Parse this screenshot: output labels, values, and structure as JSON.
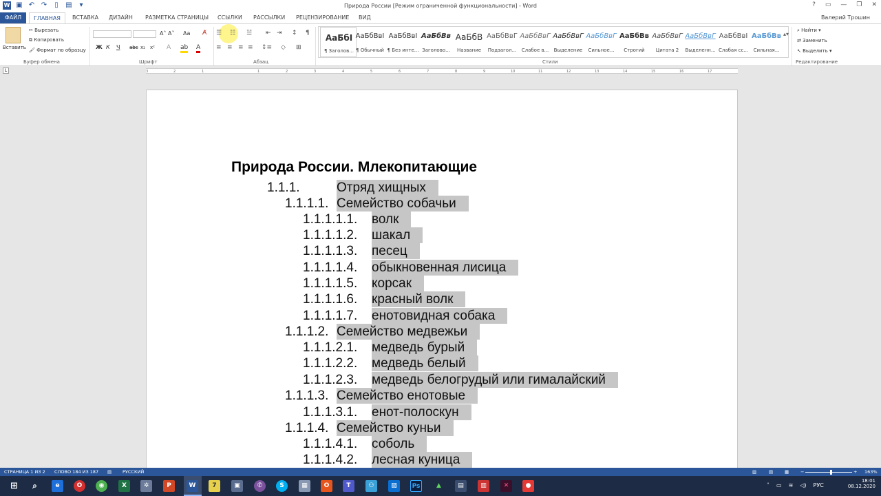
{
  "window": {
    "title": "Природа России [Режим ограниченной функциональности] - Word",
    "user": "Валерий Трошин",
    "controls": [
      "?",
      "▭",
      "—",
      "❐",
      "✕"
    ]
  },
  "tabs": [
    "ФАЙЛ",
    "ГЛАВНАЯ",
    "ВСТАВКА",
    "ДИЗАЙН",
    "РАЗМЕТКА СТРАНИЦЫ",
    "ССЫЛКИ",
    "РАССЫЛКИ",
    "РЕЦЕНЗИРОВАНИЕ",
    "ВИД"
  ],
  "ribbon": {
    "clipboard": {
      "paste": "Вставить",
      "cut": "Вырезать",
      "copy": "Копировать",
      "format_painter": "Формат по образцу",
      "label": "Буфер обмена"
    },
    "font": {
      "label": "Шрифт",
      "buttons": [
        "Ж",
        "К",
        "Ч",
        "abc",
        "x₂",
        "x²"
      ],
      "case": "Aa"
    },
    "paragraph": {
      "label": "Абзац"
    },
    "styles": {
      "label": "Стили",
      "items": [
        {
          "sample": "АаБбІ",
          "name": "¶ Заголов..."
        },
        {
          "sample": "АаБбВвІ",
          "name": "¶ Обычный"
        },
        {
          "sample": "АаБбВвІ",
          "name": "¶ Без инте..."
        },
        {
          "sample": "АаБбВв",
          "name": "Заголово..."
        },
        {
          "sample": "АаБбВ",
          "name": "Название"
        },
        {
          "sample": "АаБбВвГ",
          "name": "Подзагол..."
        },
        {
          "sample": "АаБбВвГ",
          "name": "Слабое в..."
        },
        {
          "sample": "АаБбВвГ",
          "name": "Выделение"
        },
        {
          "sample": "АаБбВвГ",
          "name": "Сильное..."
        },
        {
          "sample": "АаБбВв",
          "name": "Строгий"
        },
        {
          "sample": "АаБбВвГ",
          "name": "Цитата 2"
        },
        {
          "sample": "АаБбВвГ",
          "name": "Выделенн..."
        },
        {
          "sample": "АаБбВвІ",
          "name": "Слабая сс..."
        },
        {
          "sample": "АаБбВв",
          "name": "Сильная..."
        }
      ]
    },
    "editing": {
      "label": "Редактирование",
      "find": "Найти",
      "replace": "Заменить",
      "select": "Выделить"
    }
  },
  "ruler_ticks": [
    "3",
    "2",
    "1",
    "1",
    "2",
    "3",
    "4",
    "5",
    "6",
    "7",
    "8",
    "9",
    "10",
    "11",
    "12",
    "13",
    "14",
    "15",
    "16",
    "17"
  ],
  "document": {
    "title": "Природа России. Млекопитающие",
    "lines": [
      {
        "num": "1.1.1.",
        "text": "Отряд хищных"
      },
      {
        "num": "1.1.1.1.",
        "text": "Семейство собачьи"
      },
      {
        "num": "1.1.1.1.1.",
        "text": "волк"
      },
      {
        "num": "1.1.1.1.2.",
        "text": "шакал"
      },
      {
        "num": "1.1.1.1.3.",
        "text": "песец"
      },
      {
        "num": "1.1.1.1.4.",
        "text": "обыкновенная лисица"
      },
      {
        "num": "1.1.1.1.5.",
        "text": "корсак"
      },
      {
        "num": "1.1.1.1.6.",
        "text": "красный волк"
      },
      {
        "num": "1.1.1.1.7.",
        "text": "енотовидная собака"
      },
      {
        "num": "1.1.1.2.",
        "text": "Семейство медвежьи"
      },
      {
        "num": "1.1.1.2.1.",
        "text": "медведь бурый"
      },
      {
        "num": "1.1.1.2.2.",
        "text": "медведь белый"
      },
      {
        "num": "1.1.1.2.3.",
        "text": "медведь белогрудый или гималайский"
      },
      {
        "num": "1.1.1.3.",
        "text": "Семейство енотовые"
      },
      {
        "num": "1.1.1.3.1.",
        "text": "енот-полоскун"
      },
      {
        "num": "1.1.1.4.",
        "text": "Семейство куньи"
      },
      {
        "num": "1.1.1.4.1.",
        "text": "соболь"
      },
      {
        "num": "1.1.1.4.2.",
        "text": "лесная куница"
      }
    ]
  },
  "statusbar": {
    "page": "СТРАНИЦА 1 ИЗ 2",
    "words": "СЛОВО 184 ИЗ 187",
    "language": "РУССКИЙ",
    "zoom": "163%"
  },
  "taskbar": {
    "keyboard": "РУС",
    "time": "18:01",
    "date": "08.12.2020"
  },
  "colors": {
    "accent": "#2b579a",
    "selection": "#c6c6c6",
    "taskbar": "#1d2b44"
  }
}
